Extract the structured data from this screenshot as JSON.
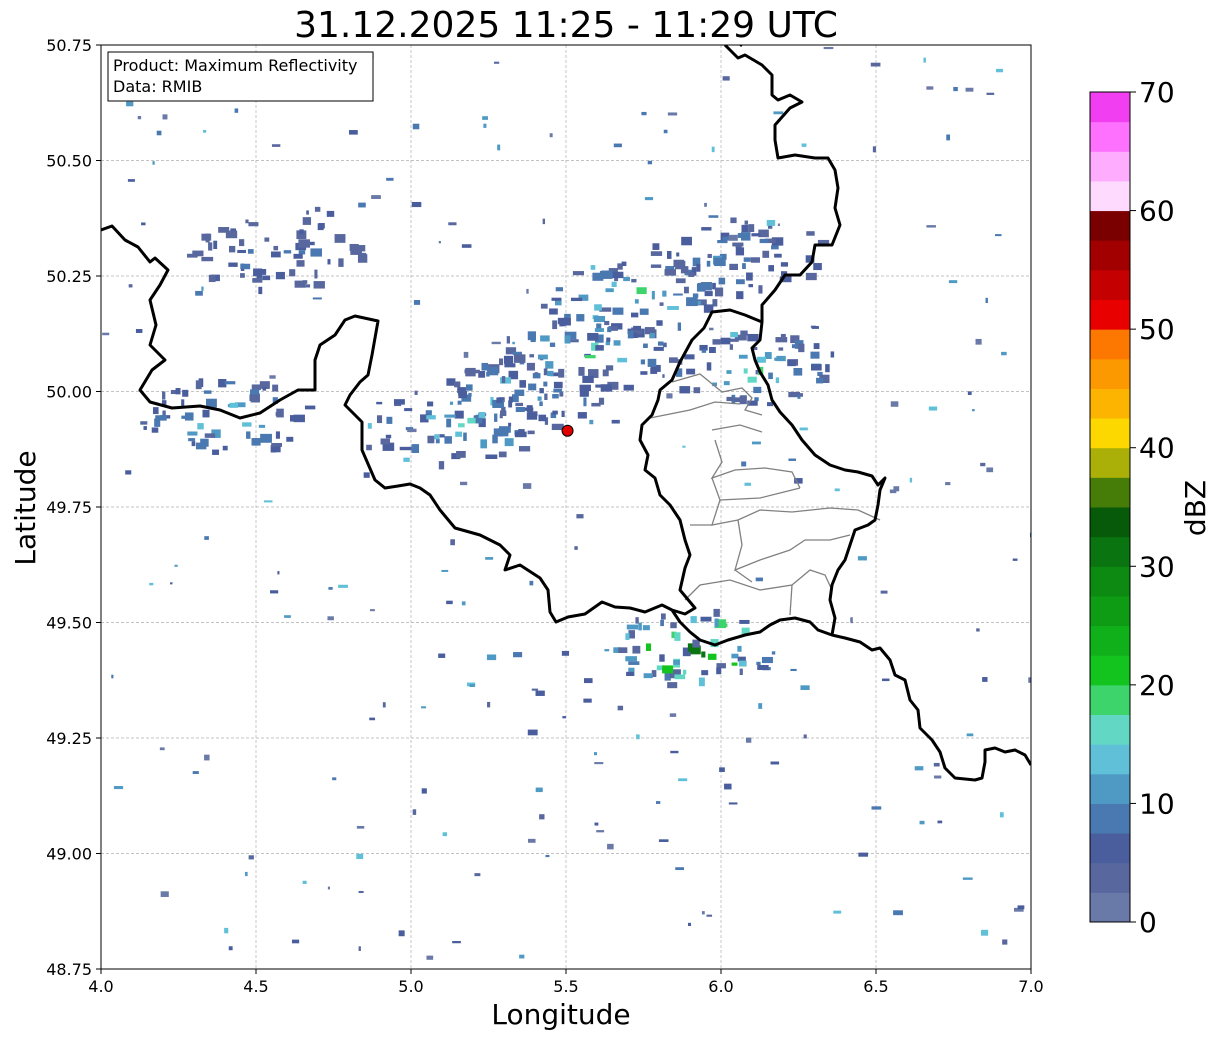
{
  "map": {
    "title": "31.12.2025 11:25 - 11:29 UTC",
    "xlabel": "Longitude",
    "ylabel": "Latitude",
    "info_lines": [
      "Product: Maximum Reflectivity",
      "Data: RMIB"
    ],
    "xlim": [
      4.0,
      7.0
    ],
    "ylim": [
      48.75,
      50.75
    ],
    "x_ticks": [
      4.0,
      4.5,
      5.0,
      5.5,
      6.0,
      6.5,
      7.0
    ],
    "y_ticks": [
      48.75,
      49.0,
      49.25,
      49.5,
      49.75,
      50.0,
      50.25,
      50.5,
      50.75
    ],
    "x_tick_labels": [
      "4.0",
      "4.5",
      "5.0",
      "5.5",
      "6.0",
      "6.5",
      "7.0"
    ],
    "y_tick_labels": [
      "48.75",
      "49.00",
      "49.25",
      "49.50",
      "49.75",
      "50.00",
      "50.25",
      "50.50",
      "50.75"
    ],
    "grid": true,
    "radar_site": {
      "lon": 5.505,
      "lat": 49.915,
      "color": "#e00000"
    }
  },
  "colorbar": {
    "label": "dBZ",
    "ticks": [
      0,
      10,
      20,
      30,
      40,
      50,
      60,
      70
    ],
    "tick_labels": [
      "0",
      "10",
      "20",
      "30",
      "40",
      "50",
      "60",
      "70"
    ],
    "colors": [
      "#6a7aa8",
      "#58689f",
      "#4a5e9e",
      "#4a78b0",
      "#4f9ac4",
      "#5fc0d8",
      "#62d8c4",
      "#3dd46c",
      "#14c41e",
      "#10b01a",
      "#0e9c14",
      "#0c8a12",
      "#0a7410",
      "#065a0a",
      "#467c08",
      "#aab008",
      "#fcd800",
      "#fcb400",
      "#fc9800",
      "#fc7800",
      "#e80000",
      "#c40000",
      "#a20000",
      "#7a0000",
      "#fedaff",
      "#feacfe",
      "#fe70fe",
      "#f03ef0"
    ]
  },
  "chart_data": {
    "type": "heatmap",
    "title": "31.12.2025 11:25 - 11:29 UTC",
    "xlabel": "Longitude",
    "ylabel": "Latitude",
    "xlim": [
      4.0,
      7.0
    ],
    "ylim": [
      48.75,
      50.75
    ],
    "colorbar_label": "dBZ",
    "colorbar_range": [
      0,
      70
    ],
    "legend_text": [
      "Product: Maximum Reflectivity",
      "Data: RMIB"
    ],
    "echo_regions": [
      {
        "lon": 5.7,
        "lat": 50.2,
        "dbz_max": 25
      },
      {
        "lon": 5.55,
        "lat": 50.08,
        "dbz_max": 22
      },
      {
        "lon": 5.35,
        "lat": 50.0,
        "dbz_max": 20
      },
      {
        "lon": 5.15,
        "lat": 49.93,
        "dbz_max": 20
      },
      {
        "lon": 4.55,
        "lat": 50.3,
        "dbz_max": 12
      },
      {
        "lon": 4.4,
        "lat": 49.95,
        "dbz_max": 18
      },
      {
        "lon": 6.05,
        "lat": 50.3,
        "dbz_max": 15
      },
      {
        "lon": 6.1,
        "lat": 50.05,
        "dbz_max": 20
      },
      {
        "lon": 5.9,
        "lat": 49.45,
        "dbz_max": 40
      }
    ]
  }
}
